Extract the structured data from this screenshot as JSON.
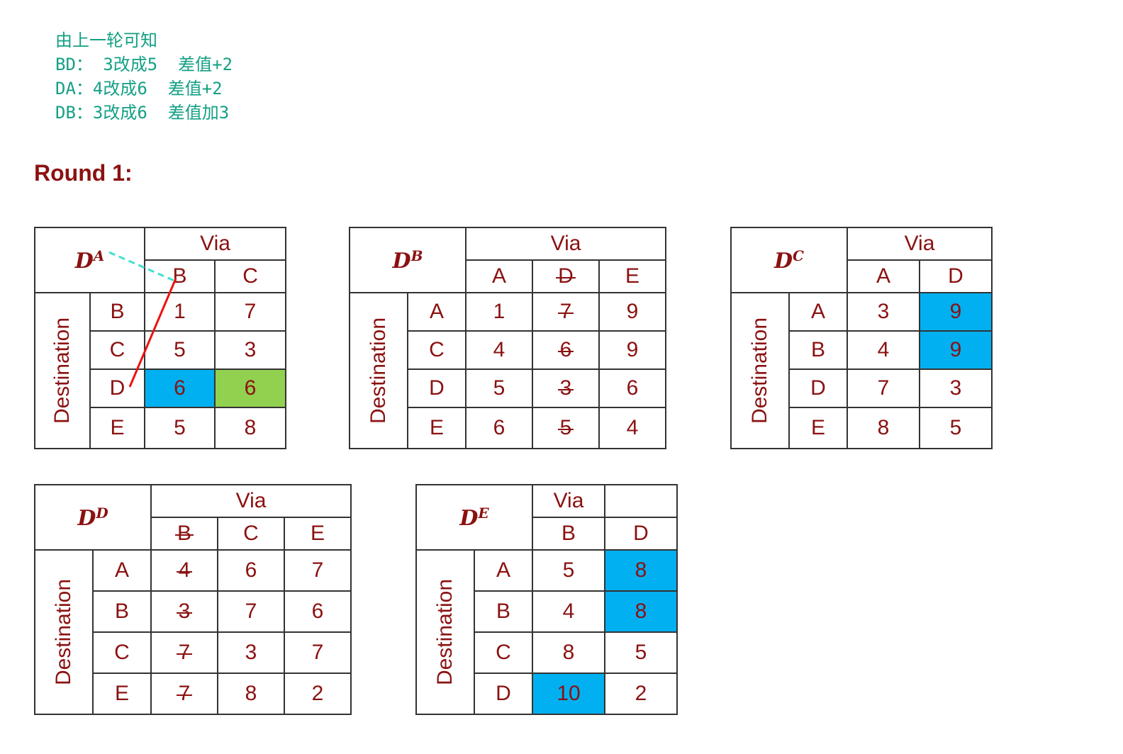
{
  "notes": [
    "由上一轮可知",
    "BD： 3改成5  差值+2",
    "DA：4改成6  差值+2",
    "DB：3改成6  差值加3"
  ],
  "round_title": "Round 1:",
  "common": {
    "via_label": "Via",
    "destination_label": "Destination"
  },
  "tables": {
    "dA": {
      "corner": {
        "base": "D",
        "sup": "A"
      },
      "via": [
        "B",
        "C"
      ],
      "rows": [
        {
          "dest": "B",
          "cells": [
            "1",
            "7"
          ]
        },
        {
          "dest": "C",
          "cells": [
            "5",
            "3"
          ]
        },
        {
          "dest": "D",
          "cells": [
            "6",
            "6"
          ]
        },
        {
          "dest": "E",
          "cells": [
            "5",
            "8"
          ]
        }
      ]
    },
    "dB": {
      "corner": {
        "base": "D",
        "sup": "B"
      },
      "via": [
        "A",
        "D",
        "E"
      ],
      "rows": [
        {
          "dest": "A",
          "cells": [
            "1",
            "7",
            "9"
          ]
        },
        {
          "dest": "C",
          "cells": [
            "4",
            "6",
            "9"
          ]
        },
        {
          "dest": "D",
          "cells": [
            "5",
            "3",
            "6"
          ]
        },
        {
          "dest": "E",
          "cells": [
            "6",
            "5",
            "4"
          ]
        }
      ]
    },
    "dC": {
      "corner": {
        "base": "D",
        "sup": "C"
      },
      "via": [
        "A",
        "D"
      ],
      "rows": [
        {
          "dest": "A",
          "cells": [
            "3",
            "9"
          ]
        },
        {
          "dest": "B",
          "cells": [
            "4",
            "9"
          ]
        },
        {
          "dest": "D",
          "cells": [
            "7",
            "3"
          ]
        },
        {
          "dest": "E",
          "cells": [
            "8",
            "5"
          ]
        }
      ]
    },
    "dD": {
      "corner": {
        "base": "D",
        "sup": "D"
      },
      "via": [
        "B",
        "C",
        "E"
      ],
      "rows": [
        {
          "dest": "A",
          "cells": [
            "4",
            "6",
            "7"
          ]
        },
        {
          "dest": "B",
          "cells": [
            "3",
            "7",
            "6"
          ]
        },
        {
          "dest": "C",
          "cells": [
            "7",
            "3",
            "7"
          ]
        },
        {
          "dest": "E",
          "cells": [
            "7",
            "8",
            "2"
          ]
        }
      ]
    },
    "dE": {
      "corner": {
        "base": "D",
        "sup": "E"
      },
      "via": [
        "B",
        "D"
      ],
      "rows": [
        {
          "dest": "A",
          "cells": [
            "5",
            "8"
          ]
        },
        {
          "dest": "B",
          "cells": [
            "4",
            "8"
          ]
        },
        {
          "dest": "C",
          "cells": [
            "8",
            "5"
          ]
        },
        {
          "dest": "D",
          "cells": [
            "10",
            "2"
          ]
        }
      ]
    }
  },
  "colors": {
    "text": "#8b1111",
    "note": "#14a085",
    "highlight_blue": "#00b0f0",
    "highlight_green": "#92d050",
    "annotation_red": "#ee1111",
    "annotation_dash": "#40e0d0"
  }
}
